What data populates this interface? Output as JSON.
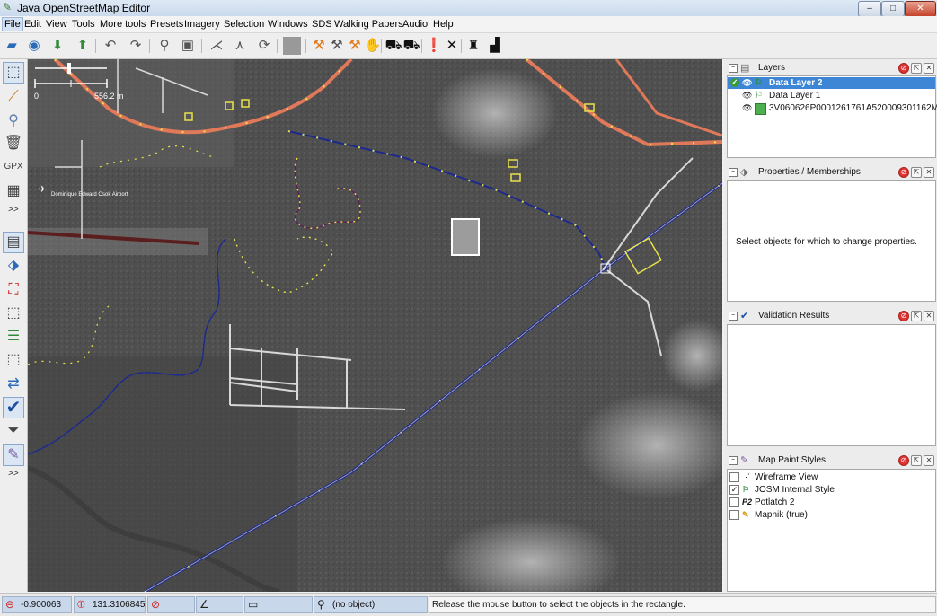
{
  "window": {
    "title": "Java OpenStreetMap Editor",
    "min": "–",
    "max": "□",
    "close": "✕"
  },
  "menu": [
    "File",
    "Edit",
    "View",
    "Tools",
    "More tools",
    "Presets",
    "Imagery",
    "Selection",
    "Windows",
    "SDS",
    "Walking Papers",
    "Audio",
    "Help"
  ],
  "map": {
    "scale_zero": "0",
    "scale_label": "556.2 m",
    "airport_label": "Dominique Edward Osok Airport"
  },
  "left_tools_more": [
    ">>",
    ">>"
  ],
  "panels": {
    "layers": {
      "title": "Layers",
      "items": [
        {
          "name": "Data Layer 2",
          "selected": true
        },
        {
          "name": "Data Layer 1",
          "selected": false
        },
        {
          "name": "3V060626P0001261761A520009301162M...",
          "selected": false
        }
      ]
    },
    "properties": {
      "title": "Properties / Memberships",
      "message": "Select objects for which to change properties."
    },
    "validation": {
      "title": "Validation Results"
    },
    "paint_styles": {
      "title": "Map Paint Styles",
      "items": [
        {
          "label": "Wireframe View",
          "checked": false,
          "icon": "wireframe-icon"
        },
        {
          "label": "JOSM Internal Style",
          "checked": true,
          "icon": "josm-style-icon"
        },
        {
          "label": "Potlatch 2",
          "checked": false,
          "icon": "P2"
        },
        {
          "label": "Mapnik (true)",
          "checked": false,
          "icon": "pencil-icon"
        }
      ]
    }
  },
  "status": {
    "lat": "-0.900063",
    "lon": "131.3106845",
    "heading": "",
    "angle": "",
    "distance": "",
    "object": "(no object)",
    "message": "Release the mouse button to select the objects in the rectangle."
  },
  "colors": {
    "selected_layer": "#3d86d6",
    "road_blue": "#1d2a8c",
    "road_orange": "#e0785a",
    "node_yellow": "#e8e24a",
    "status_field": "#c9d7ea"
  }
}
